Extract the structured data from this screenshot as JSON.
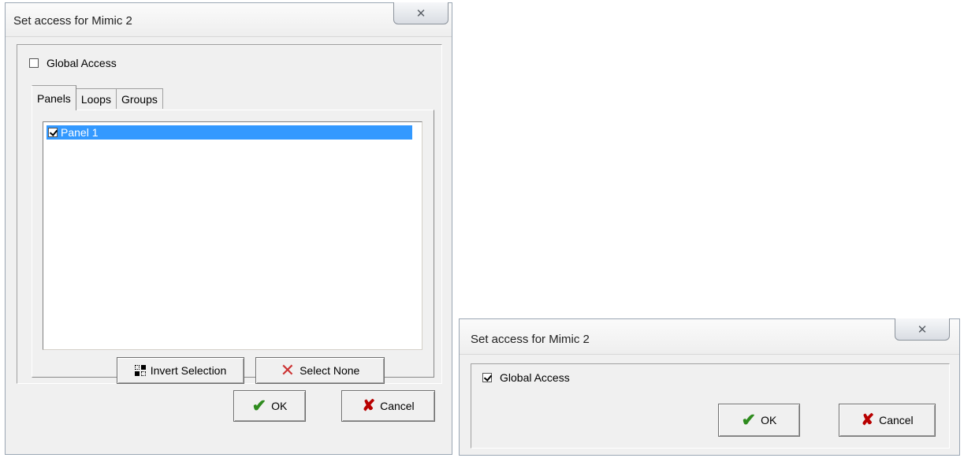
{
  "dialog_full": {
    "title": "Set access for Mimic 2",
    "close_glyph": "✕",
    "global_access": {
      "label": "Global Access",
      "checked": false
    },
    "tabs": [
      {
        "label": "Panels",
        "active": true
      },
      {
        "label": "Loops",
        "active": false
      },
      {
        "label": "Groups",
        "active": false
      }
    ],
    "list_items": [
      {
        "label": "Panel 1",
        "checked": true,
        "selected": true
      }
    ],
    "invert_button_label": "Invert Selection",
    "select_none_button_label": "Select None",
    "ok_label": "OK",
    "cancel_label": "Cancel"
  },
  "dialog_compact": {
    "title": "Set access for Mimic 2",
    "close_glyph": "✕",
    "global_access": {
      "label": "Global Access",
      "checked": true
    },
    "ok_label": "OK",
    "cancel_label": "Cancel"
  },
  "icons": {
    "ok": "check-icon",
    "cancel": "red-x-icon",
    "select_none": "thin-x-icon",
    "invert": "invert-selection-icon",
    "close": "close-icon"
  },
  "colors": {
    "selection": "#3399ff",
    "ok_check": "#2e8b1e",
    "cancel_x": "#b80000"
  }
}
